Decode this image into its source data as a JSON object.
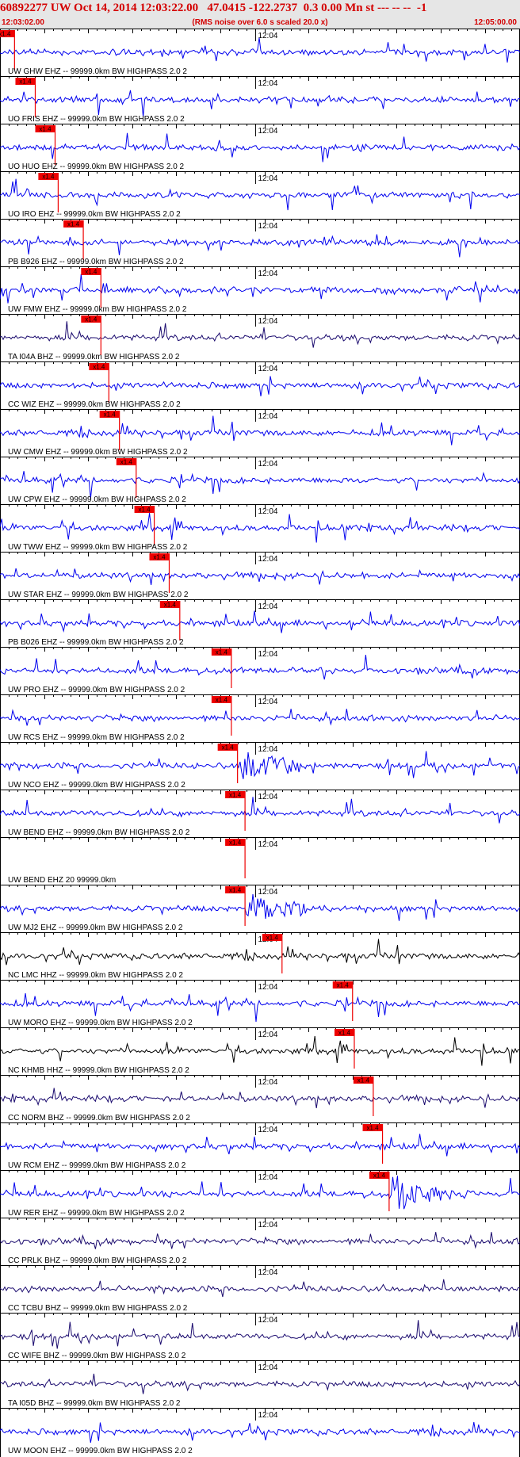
{
  "header": {
    "title": "60892277 UW Oct 14, 2014 12:03:22.00   47.0415 -122.2737  0.3 0.00 Mn st --- -- --  -1",
    "start_time": "12:03:02.00",
    "scale_note": "(RMS noise over 6.0 s scaled 20.0 x)",
    "end_time": "12:05:00.00"
  },
  "colors": {
    "header_bg": "#e6e6e6",
    "header_text": "#d40000",
    "trace_blue": "#0000ee",
    "trace_dark": "#000000",
    "trace_purple": "#1a0a6e",
    "pick_red": "#ee0000",
    "tick_black": "#000000"
  },
  "chart_data": {
    "type": "line",
    "title": "60892277 UW Oct 14, 2014 12:03:22.00   47.0415 -122.2737  0.3 0.00 Mn st --- -- --  -1",
    "x_axis": {
      "start": "12:03:02.00",
      "end": "12:05:00.00",
      "minute_mark": "12:04",
      "unit": "seconds after 12:03:02.00",
      "range": [
        0,
        118
      ]
    },
    "pick_label": "x1.4",
    "channels": [
      {
        "label": "UW GHW EHZ -- 99999.0km BW  HIGHPASS  2.0  2",
        "color": "blue",
        "pick": 3.3,
        "burst": false
      },
      {
        "label": "UO FRIS EHZ -- 99999.0km BW  HIGHPASS  2.0  2",
        "color": "blue",
        "pick": 8.0,
        "burst": false
      },
      {
        "label": "UO HUO EHZ -- 99999.0km BW  HIGHPASS  2.0  2",
        "color": "blue",
        "pick": 12.5,
        "burst": false
      },
      {
        "label": "UO IRO EHZ -- 99999.0km BW  HIGHPASS  2.0  2",
        "color": "blue",
        "pick": 13.2,
        "burst": false
      },
      {
        "label": "PB B926 EHZ -- 99999.0km BW  HIGHPASS  2.0  2",
        "color": "blue",
        "pick": 18.9,
        "burst": false
      },
      {
        "label": "UW FMW EHZ -- 99999.0km BW  HIGHPASS  2.0  2",
        "color": "blue",
        "pick": 22.9,
        "burst": false
      },
      {
        "label": "TA I04A BHZ -- 99999.0km BW  HIGHPASS  2.0  2",
        "color": "purple",
        "pick": 22.9,
        "burst": false
      },
      {
        "label": "CC WIZ EHZ -- 99999.0km BW  HIGHPASS  2.0  2",
        "color": "blue",
        "pick": 24.7,
        "burst": false
      },
      {
        "label": "UW CMW EHZ -- 99999.0km BW  HIGHPASS  2.0  2",
        "color": "blue",
        "pick": 27.1,
        "burst": false
      },
      {
        "label": "UW CPW EHZ -- 99999.0km BW  HIGHPASS  2.0  2",
        "color": "blue",
        "pick": 30.9,
        "burst": false
      },
      {
        "label": "UW TWW EHZ -- 99999.0km BW  HIGHPASS  2.0  2",
        "color": "blue",
        "pick": 35.0,
        "burst": false
      },
      {
        "label": "UW STAR EHZ -- 99999.0km BW  HIGHPASS  2.0  2",
        "color": "blue",
        "pick": 38.4,
        "burst": false
      },
      {
        "label": "PB B026 EHZ -- 99999.0km BW  HIGHPASS  2.0  2",
        "color": "blue",
        "pick": 40.8,
        "burst": false
      },
      {
        "label": "UW PRO EHZ -- 99999.0km BW  HIGHPASS  2.0  2",
        "color": "blue",
        "pick": 52.5,
        "burst": false
      },
      {
        "label": "UW RCS EHZ -- 99999.0km BW  HIGHPASS  2.0  2",
        "color": "blue",
        "pick": 52.5,
        "burst": false
      },
      {
        "label": "UW NCO EHZ -- 99999.0km BW  HIGHPASS  2.0  2",
        "color": "blue",
        "pick": 53.9,
        "burst": true
      },
      {
        "label": "UW BEND EHZ -- 99999.0km BW  HIGHPASS  2.0  2",
        "color": "blue",
        "pick": 55.6,
        "burst": false
      },
      {
        "label": "UW BEND EHZ 20 99999.0km",
        "color": "none",
        "pick": 55.6,
        "burst": false
      },
      {
        "label": "UW MJ2 EHZ -- 99999.0km BW  HIGHPASS  2.0  2",
        "color": "blue",
        "pick": 55.6,
        "burst": true
      },
      {
        "label": "NC LMC HHZ -- 99999.0km BW  HIGHPASS  2.0  2",
        "color": "black",
        "pick": 64.0,
        "burst": false
      },
      {
        "label": "UW MORO EHZ -- 99999.0km BW  HIGHPASS  2.0  2",
        "color": "blue",
        "pick": 80.0,
        "burst": false
      },
      {
        "label": "NC KHMB HHZ -- 99999.0km BW  HIGHPASS  2.0  2",
        "color": "black",
        "pick": 80.4,
        "burst": false
      },
      {
        "label": "CC NORM BHZ -- 99999.0km BW  HIGHPASS  2.0  2",
        "color": "purple",
        "pick": 84.7,
        "burst": false
      },
      {
        "label": "UW RCM EHZ -- 99999.0km BW  HIGHPASS  2.0  2",
        "color": "blue",
        "pick": 86.8,
        "burst": false
      },
      {
        "label": "UW RER EHZ -- 99999.0km BW  HIGHPASS  2.0  2",
        "color": "blue",
        "pick": 88.3,
        "burst": true
      },
      {
        "label": "CC PRLK BHZ -- 99999.0km BW  HIGHPASS  2.0  2",
        "color": "purple",
        "pick": null,
        "burst": false
      },
      {
        "label": "CC TCBU BHZ -- 99999.0km BW  HIGHPASS  2.0  2",
        "color": "purple",
        "pick": null,
        "burst": false
      },
      {
        "label": "CC WIFE BHZ -- 99999.0km BW  HIGHPASS  2.0  2",
        "color": "purple",
        "pick": null,
        "burst": false
      },
      {
        "label": "TA I05D BHZ -- 99999.0km BW  HIGHPASS  2.0  2",
        "color": "purple",
        "pick": null,
        "burst": false
      },
      {
        "label": "UW MOON EHZ -- 99999.0km BW  HIGHPASS  2.0  2",
        "color": "blue",
        "pick": null,
        "burst": false
      }
    ]
  }
}
